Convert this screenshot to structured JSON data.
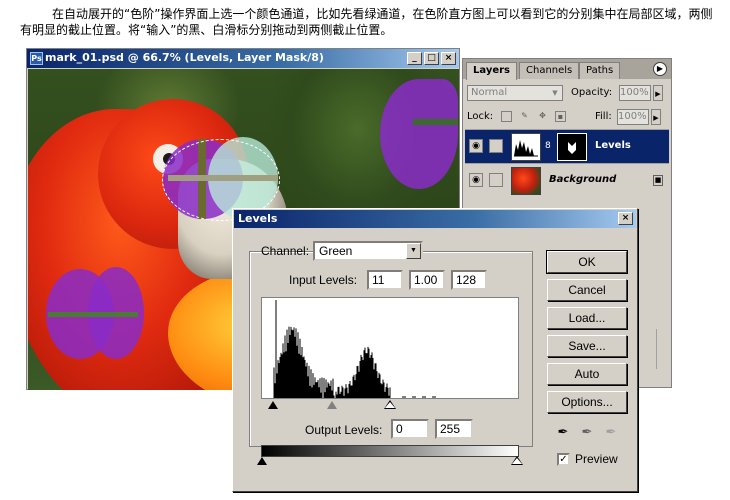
{
  "caption": "在自动展开的“色阶”操作界面上选一个颜色通道，比如先看绿通道，在色阶直方图上可以看到它的分别集中在局部区域，两侧有明显的截止位置。将“输入”的黑、白滑标分别拖动到两侧截止位置。",
  "document_window": {
    "title": "mark_01.psd @ 66.7% (Levels, Layer Mask/8)",
    "buttons": [
      "_",
      "□",
      "×"
    ]
  },
  "layers_palette": {
    "tabs": [
      "Layers",
      "Channels",
      "Paths"
    ],
    "blend_mode": "Normal",
    "opacity_label": "Opacity:",
    "opacity_value": "100%",
    "lock_label": "Lock:",
    "fill_label": "Fill:",
    "fill_value": "100%",
    "layers": [
      {
        "name": "Levels",
        "selected": true
      },
      {
        "name": "Background",
        "selected": false
      }
    ]
  },
  "levels_dialog": {
    "title": "Levels",
    "channel_label": "Channel:",
    "channel_value": "Green",
    "input_levels_label": "Input Levels:",
    "input_black": "11",
    "input_gamma": "1.00",
    "input_white": "128",
    "output_levels_label": "Output Levels:",
    "output_black": "0",
    "output_white": "255",
    "buttons": {
      "ok": "OK",
      "cancel": "Cancel",
      "load": "Load...",
      "save": "Save...",
      "auto": "Auto",
      "options": "Options..."
    },
    "preview_label": "Preview",
    "preview_checked": true
  },
  "colors": {
    "titlebar": "#0a246a",
    "dialog_bg": "#d4d0c8",
    "mask_purple": "#8a2cc8"
  }
}
